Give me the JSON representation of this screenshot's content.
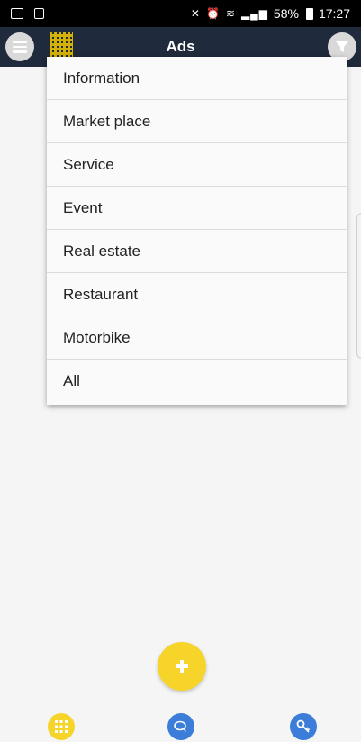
{
  "status_bar": {
    "battery": "58%",
    "time": "17:27",
    "icons": [
      "image-icon",
      "doc-icon",
      "mute-icon",
      "alarm-icon",
      "wifi-icon",
      "signal-icon",
      "battery-icon"
    ]
  },
  "appbar": {
    "title": "Ads",
    "menu_icon": "menu-icon",
    "filter_icon": "filter-icon",
    "background": "#1f2a3c"
  },
  "dropdown": {
    "items": [
      {
        "label": "Information"
      },
      {
        "label": "Market place"
      },
      {
        "label": "Service"
      },
      {
        "label": "Event"
      },
      {
        "label": "Real estate"
      },
      {
        "label": "Restaurant"
      },
      {
        "label": "Motorbike"
      },
      {
        "label": "All"
      }
    ]
  },
  "fab": {
    "icon": "plus-icon",
    "color": "#f7d42a"
  },
  "bottom_nav": [
    {
      "icon": "apps-grid-icon",
      "color": "#f7d42a"
    },
    {
      "icon": "chat-icon",
      "color": "#3b7dd8"
    },
    {
      "icon": "key-icon",
      "color": "#3b7dd8"
    }
  ]
}
